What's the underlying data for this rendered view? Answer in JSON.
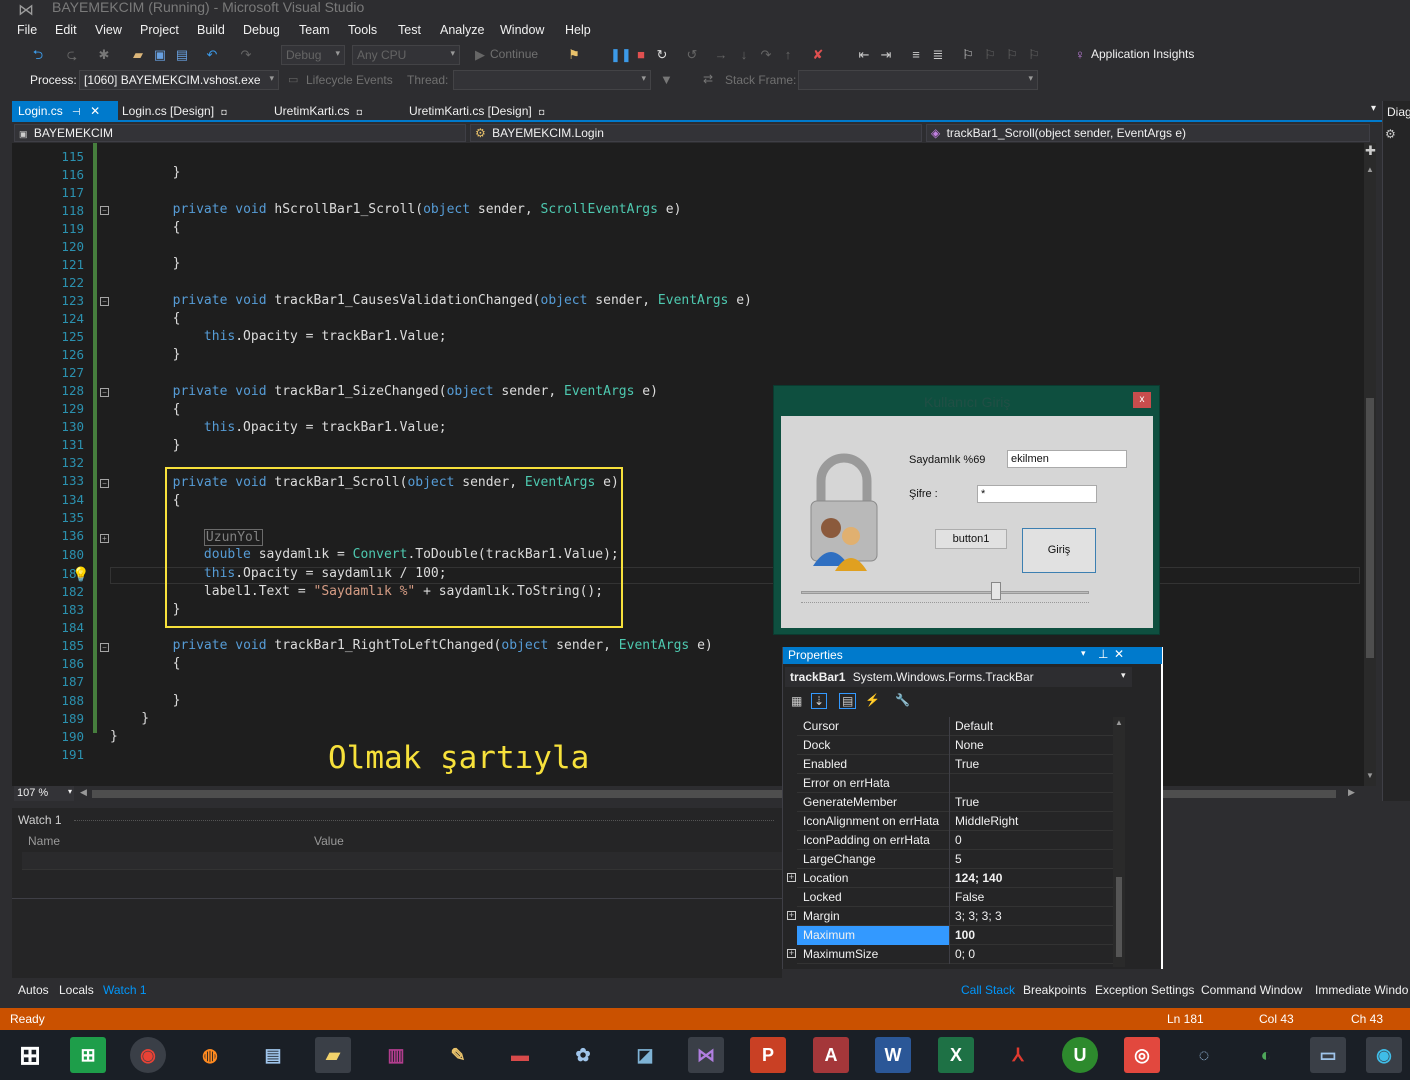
{
  "window": {
    "title": "BAYEMEKCIM (Running) - Microsoft Visual Studio",
    "logo_icon": "vs-logo-icon"
  },
  "menu": [
    "File",
    "Edit",
    "View",
    "Project",
    "Build",
    "Debug",
    "Team",
    "Tools",
    "Test",
    "Analyze",
    "Window",
    "Help"
  ],
  "toolbar": {
    "config": "Debug",
    "platform": "Any CPU",
    "continue_label": "Continue",
    "app_insights": "Application Insights"
  },
  "debug_location": {
    "process_label": "Process:",
    "process_value": "[1060] BAYEMEKCIM.vshost.exe",
    "lifecycle_label": "Lifecycle Events",
    "thread_label": "Thread:",
    "stack_frame_label": "Stack Frame:"
  },
  "tabs": [
    {
      "label": "Login.cs",
      "active": true
    },
    {
      "label": "Login.cs [Design]"
    },
    {
      "label": "UretimKarti.cs"
    },
    {
      "label": "UretimKarti.cs [Design]"
    }
  ],
  "nav": {
    "project": "BAYEMEKCIM",
    "class": "BAYEMEKCIM.Login",
    "member": "trackBar1_Scroll(object sender, EventArgs e)"
  },
  "editor": {
    "line_numbers": [
      "115",
      "116",
      "117",
      "118",
      "119",
      "120",
      "121",
      "122",
      "123",
      "124",
      "125",
      "126",
      "127",
      "128",
      "129",
      "130",
      "131",
      "132",
      "133",
      "134",
      "135",
      "136",
      "180",
      "181",
      "182",
      "183",
      "184",
      "185",
      "186",
      "187",
      "188",
      "189",
      "190",
      "191"
    ],
    "region_label": "UzunYol",
    "overlay_caption": "Olmak şartıyla",
    "zoom": "107 %"
  },
  "form_preview": {
    "title": "Kullanıcı Giriş",
    "close": "x",
    "opacity_label": "Saydamlık %69",
    "opacity_text": "ekilmen",
    "password_label": "Şifre :",
    "password_value": "*",
    "button1": "button1",
    "login_button": "Giriş"
  },
  "properties": {
    "header": "Properties",
    "object_name": "trackBar1",
    "object_type": "System.Windows.Forms.TrackBar",
    "rows": [
      {
        "name": "Cursor",
        "value": "Default"
      },
      {
        "name": "Dock",
        "value": "None"
      },
      {
        "name": "Enabled",
        "value": "True"
      },
      {
        "name": "Error on errHata",
        "value": ""
      },
      {
        "name": "GenerateMember",
        "value": "True"
      },
      {
        "name": "IconAlignment on errHata",
        "value": "MiddleRight"
      },
      {
        "name": "IconPadding on errHata",
        "value": "0"
      },
      {
        "name": "LargeChange",
        "value": "5"
      },
      {
        "name": "Location",
        "value": "124; 140"
      },
      {
        "name": "Locked",
        "value": "False"
      },
      {
        "name": "Margin",
        "value": "3; 3; 3; 3"
      },
      {
        "name": "Maximum",
        "value": "100"
      },
      {
        "name": "MaximumSize",
        "value": "0; 0"
      }
    ]
  },
  "watch": {
    "title": "Watch 1",
    "col_name": "Name",
    "col_value": "Value"
  },
  "bottom_tabs_left": [
    "Autos",
    "Locals",
    "Watch 1"
  ],
  "bottom_tabs_right": [
    "Call Stack",
    "Breakpoints",
    "Exception Settings",
    "Command Window",
    "Immediate Windo"
  ],
  "status": {
    "text": "Ready",
    "line": "Ln 181",
    "col": "Col 43",
    "ch": "Ch 43"
  },
  "right_panel": {
    "label": "Diag"
  },
  "colors": {
    "accent": "#007acc",
    "status": "#ca5100",
    "highlight": "#f7e13b"
  }
}
